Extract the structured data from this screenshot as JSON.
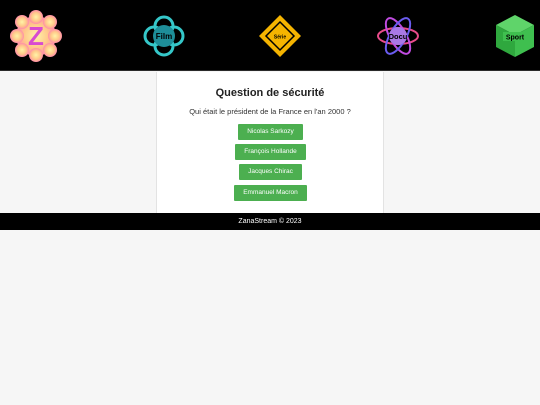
{
  "header": {
    "logos": [
      {
        "label": "Z",
        "icon": "zanastream-logo"
      },
      {
        "label": "Film",
        "icon": "film-knot-icon"
      },
      {
        "label": "Série",
        "icon": "serie-diamond-icon"
      },
      {
        "label": "Docu",
        "icon": "docu-atom-icon"
      },
      {
        "label": "Sport",
        "icon": "sport-cube-icon"
      }
    ]
  },
  "security": {
    "title": "Question de sécurité",
    "question": "Qui était le président de la France en l'an 2000 ?",
    "answers": [
      "Nicolas Sarkozy",
      "François Hollande",
      "Jacques Chirac",
      "Emmanuel Macron"
    ],
    "button_color": "#4caf50"
  },
  "footer": {
    "text": "ZanaStream © 2023"
  }
}
